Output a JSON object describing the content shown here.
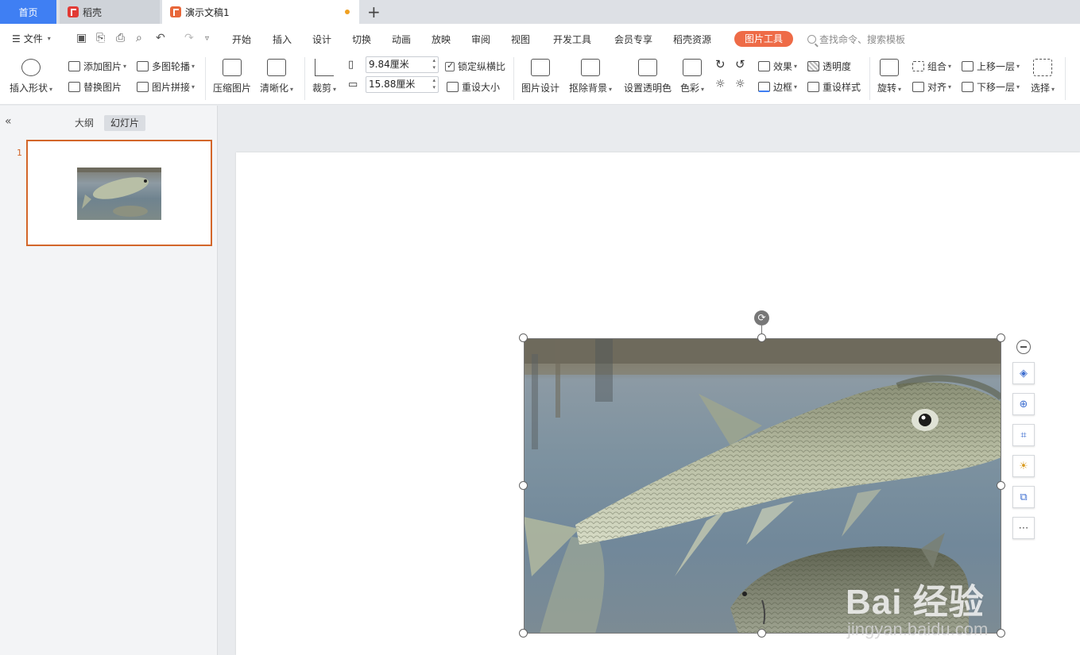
{
  "tabs": {
    "home": "首页",
    "docer": "稻壳",
    "doc": "演示文稿1"
  },
  "menu": {
    "file": "文件",
    "items": [
      "开始",
      "插入",
      "设计",
      "切换",
      "动画",
      "放映",
      "审阅",
      "视图",
      "开发工具",
      "会员专享",
      "稻壳资源"
    ],
    "picture_tool": "图片工具",
    "search_placeholder": "查找命令、搜索模板"
  },
  "ribbon": {
    "insert_shape": "插入形状",
    "add_picture": "添加图片",
    "replace_picture": "替换图片",
    "multi_carousel": "多图轮播",
    "picture_collage": "图片拼接",
    "compress": "压缩图片",
    "sharpen": "清晰化",
    "crop": "裁剪",
    "height": "9.84厘米",
    "width": "15.88厘米",
    "lock_ratio": "锁定纵横比",
    "reset_size": "重设大小",
    "picture_design": "图片设计",
    "remove_bg": "抠除背景",
    "set_transparent": "设置透明色",
    "color": "色彩",
    "effects": "效果",
    "transparency": "透明度",
    "border": "边框",
    "reset_style": "重设样式",
    "rotate": "旋转",
    "group": "组合",
    "align": "对齐",
    "bring_forward": "上移一层",
    "send_backward": "下移一层",
    "select": "选择"
  },
  "panel": {
    "outline": "大纲",
    "slides": "幻灯片",
    "slide_number": "1"
  },
  "watermark": {
    "main": "Bai 经验",
    "sub": "jingyan.baidu.com"
  },
  "icons": [
    "rotate-icon",
    "layers-icon",
    "zoom-in-icon",
    "crop-icon",
    "bulb-icon",
    "image-convert-icon",
    "more-icon"
  ]
}
